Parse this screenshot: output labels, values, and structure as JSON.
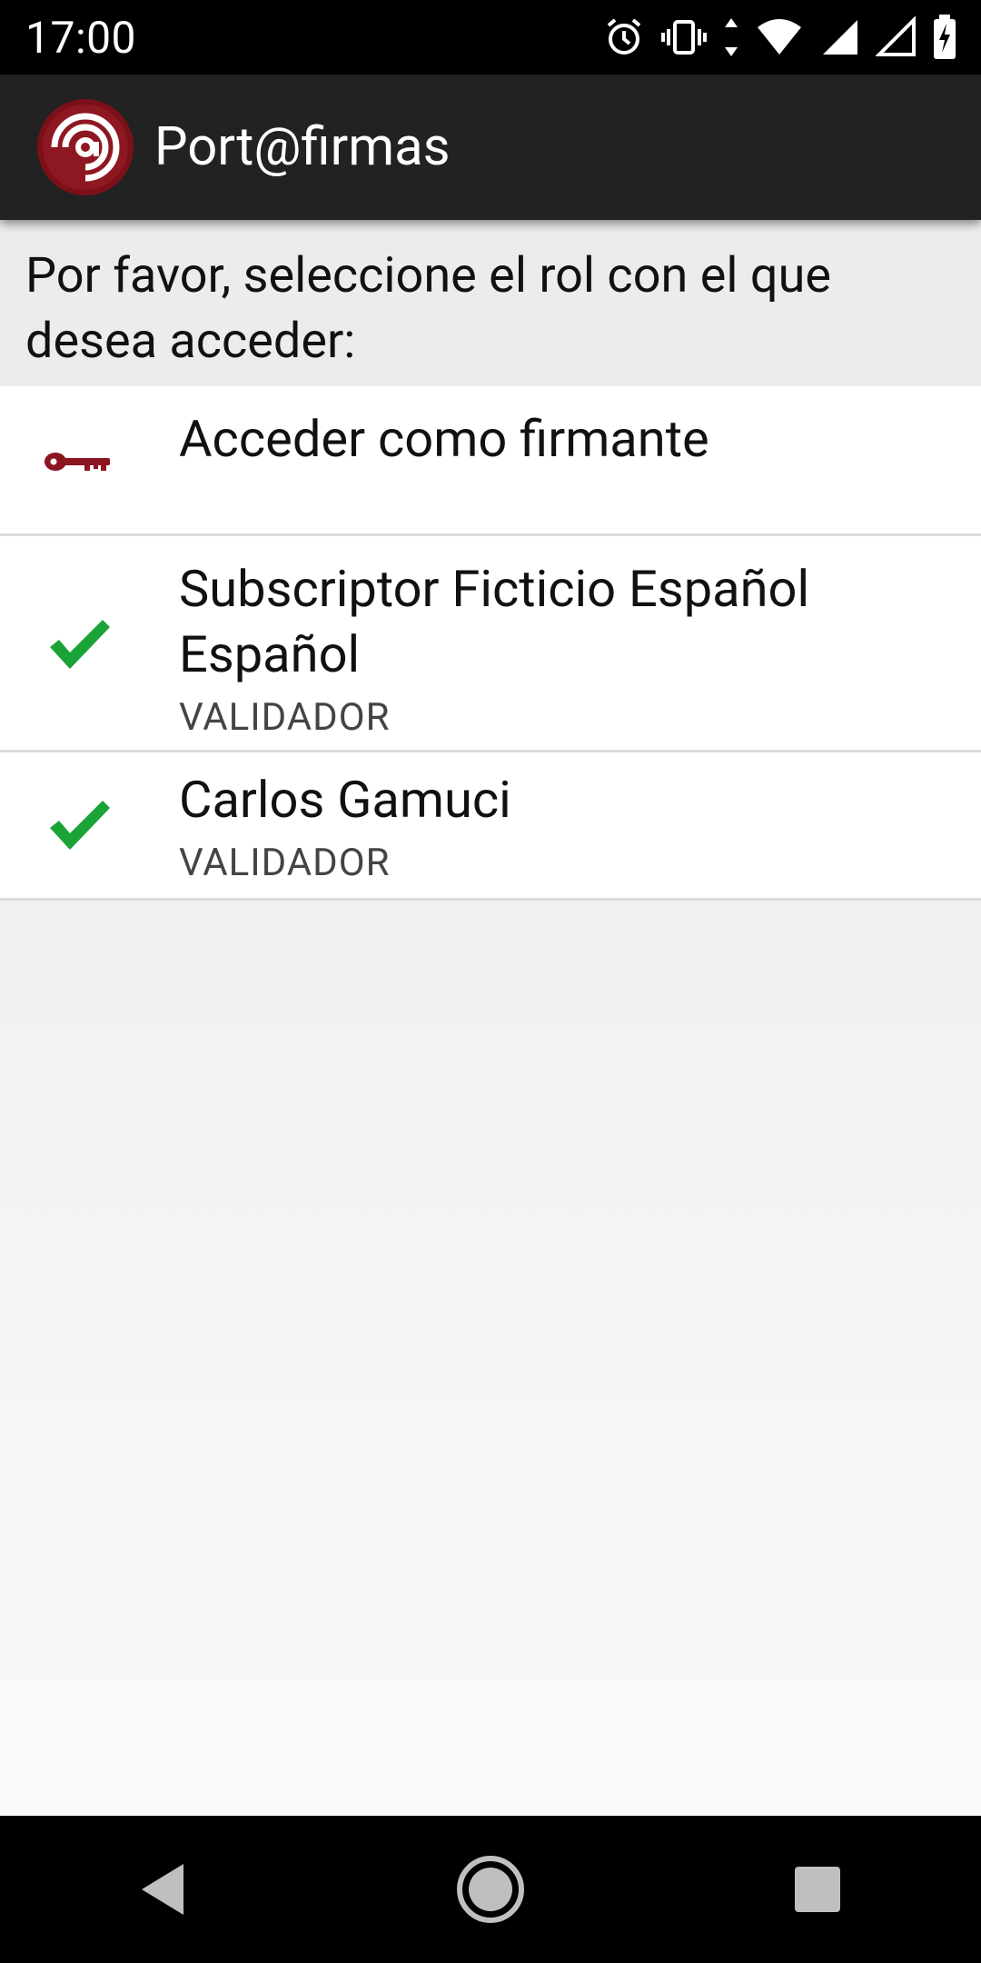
{
  "status_bar": {
    "time": "17:00",
    "icons": [
      "alarm-icon",
      "vibrate-icon",
      "data-arrows-icon",
      "wifi-icon",
      "signal-icon",
      "signal-icon",
      "battery-charging-icon"
    ]
  },
  "app_bar": {
    "title": "Port@firmas",
    "logo": "portafirmas-logo"
  },
  "prompt": {
    "text": "Por favor, seleccione el rol con el que desea acceder:"
  },
  "roles": [
    {
      "name": "Acceder como firmante",
      "role": "",
      "icon": "key-icon"
    },
    {
      "name": "Subscriptor Ficticio Español Español",
      "role": "VALIDADOR",
      "icon": "checkmark-icon"
    },
    {
      "name": "Carlos Gamuci",
      "role": "VALIDADOR",
      "icon": "checkmark-icon"
    }
  ],
  "colors": {
    "app_bar": "#222222",
    "key": "#8b1520",
    "check": "#1aa336",
    "prompt_bg": "#ececec"
  },
  "nav_bar": {
    "buttons": [
      "back-icon",
      "home-icon",
      "recents-icon"
    ]
  }
}
